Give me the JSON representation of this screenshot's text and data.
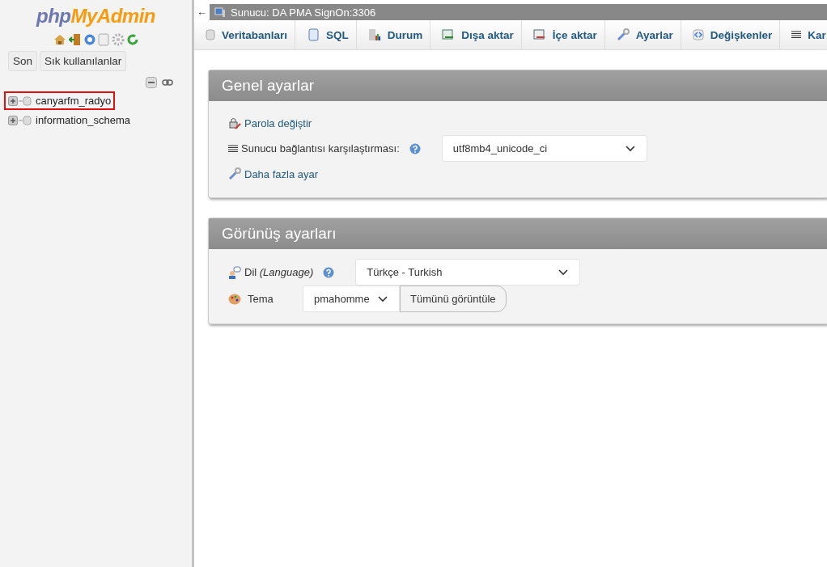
{
  "sidebar": {
    "logo": {
      "left": "php",
      "right": "MyAdmin"
    },
    "buttons": [
      "Son",
      "Sık kullanılanlar"
    ],
    "databases": [
      {
        "name": "canyarfm_radyo",
        "highlighted": true
      },
      {
        "name": "information_schema",
        "highlighted": false
      }
    ]
  },
  "breadcrumb": {
    "arrow": "←",
    "server": "Sunucu: DA PMA SignOn:3306"
  },
  "tabs": [
    {
      "label": "Veritabanları",
      "kind": "db"
    },
    {
      "label": "SQL",
      "kind": "sql"
    },
    {
      "label": "Durum",
      "kind": "chart"
    },
    {
      "label": "Dışa aktar",
      "kind": "export"
    },
    {
      "label": "İçe aktar",
      "kind": "import"
    },
    {
      "label": "Ayarlar",
      "kind": "wrench"
    },
    {
      "label": "Değişkenler",
      "kind": "vars"
    },
    {
      "label": "Kar",
      "kind": "lines"
    }
  ],
  "panels": [
    {
      "title": "Genel ayarlar",
      "rows": [
        {
          "kind": "link",
          "text": "Parola değiştir"
        },
        {
          "kind": "select",
          "label": "Sunucu bağlantısı karşılaştırması:",
          "value": "utf8mb4_unicode_ci"
        },
        {
          "kind": "link",
          "text": "Daha fazla ayar"
        }
      ]
    },
    {
      "title": "Görünüş ayarları",
      "rows": [
        {
          "kind": "select",
          "label": "Dil *(Language)*",
          "value": "Türkçe - Turkish"
        },
        {
          "kind": "theme",
          "label": "Tema",
          "value": "pmahomme",
          "button": "Tümünü görüntüle"
        }
      ]
    }
  ]
}
